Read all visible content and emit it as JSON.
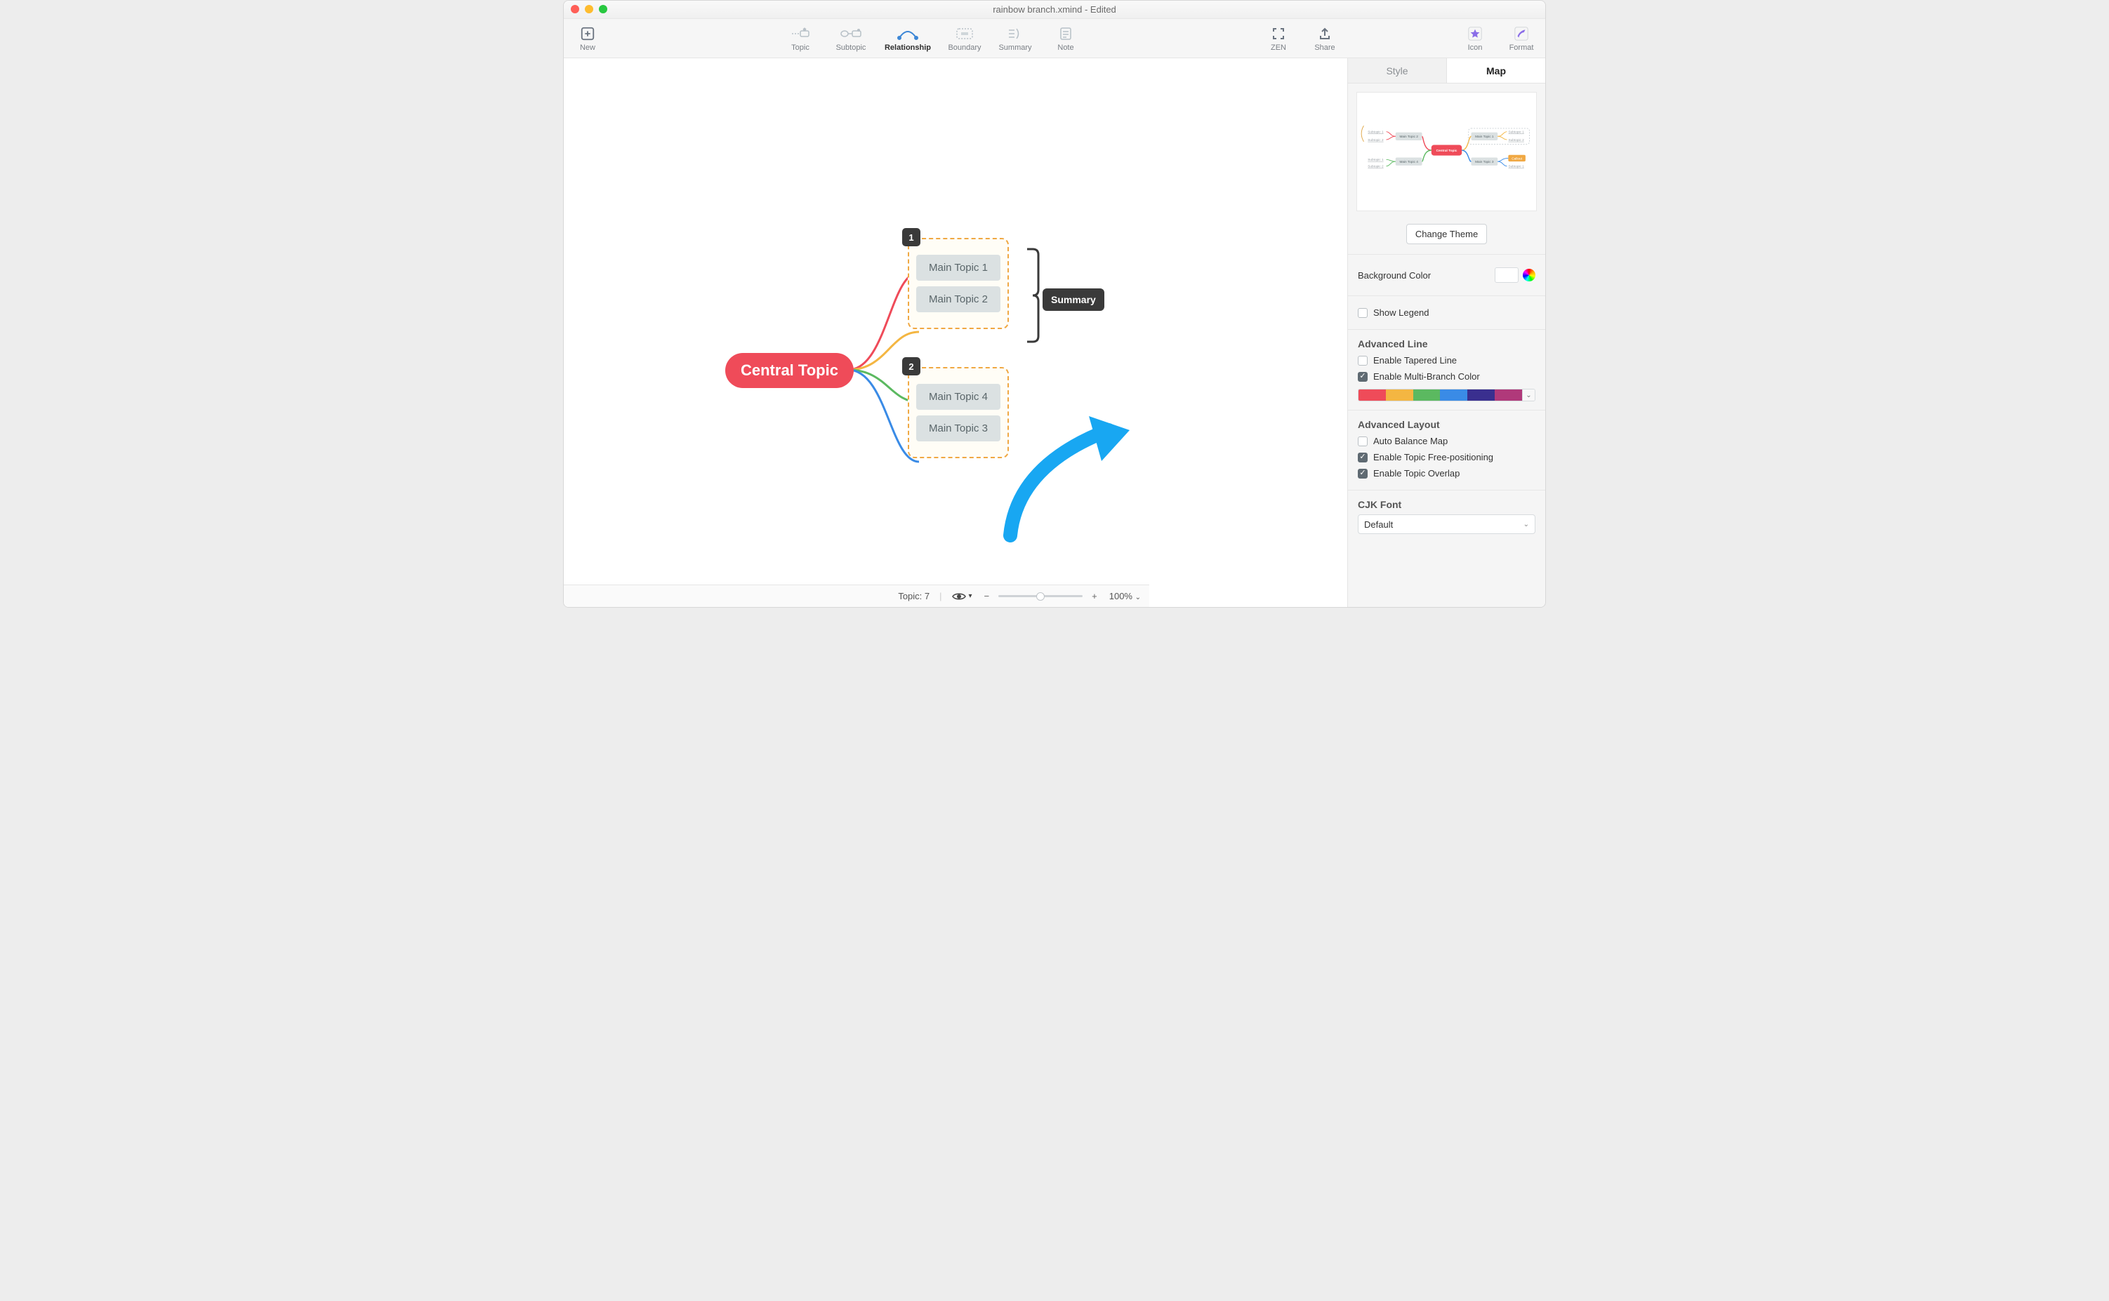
{
  "title": "rainbow branch.xmind - Edited",
  "toolbar": {
    "new": "New",
    "topic": "Topic",
    "subtopic": "Subtopic",
    "relationship": "Relationship",
    "boundary": "Boundary",
    "summary": "Summary",
    "note": "Note",
    "zen": "ZEN",
    "share": "Share",
    "icon": "Icon",
    "format": "Format"
  },
  "panel": {
    "tabs": {
      "style": "Style",
      "map": "Map"
    },
    "change_theme": "Change Theme",
    "bg_label": "Background Color",
    "show_legend": "Show Legend",
    "adv_line": "Advanced Line",
    "tapered": "Enable Tapered Line",
    "multi": "Enable Multi-Branch Color",
    "adv_layout": "Advanced Layout",
    "auto_balance": "Auto Balance Map",
    "free_pos": "Enable Topic Free-positioning",
    "overlap": "Enable Topic Overlap",
    "cjk": "CJK Font",
    "cjk_value": "Default",
    "palette": [
      "#ef4b59",
      "#f4b642",
      "#5bb960",
      "#3a8be6",
      "#3a2f8f",
      "#b0397a"
    ],
    "checks": {
      "show_legend": false,
      "tapered": false,
      "multi": true,
      "auto_balance": false,
      "free_pos": true,
      "overlap": true
    }
  },
  "map": {
    "central": "Central Topic",
    "g1": {
      "tag": "1",
      "topics": [
        "Main Topic 1",
        "Main Topic 2"
      ]
    },
    "g2": {
      "tag": "2",
      "topics": [
        "Main Topic 4",
        "Main Topic 3"
      ]
    },
    "summary": "Summary"
  },
  "status": {
    "topic_label": "Topic: 7",
    "zoom": "100%"
  },
  "preview": {
    "central": "Central Topic",
    "left1": "Main Topic 2",
    "left2": "Main Topic 4",
    "right1": "Main Topic 1",
    "right2": "Main Topic 3",
    "sub_a": "Subtopic 1",
    "sub_b": "Subtopic 2",
    "sub_c": "Subtopic 1",
    "sub_d": "Subtopic 2",
    "sub_e": "Subtopic 1",
    "sub_f": "Subtopic 2",
    "callout": "Callout"
  }
}
